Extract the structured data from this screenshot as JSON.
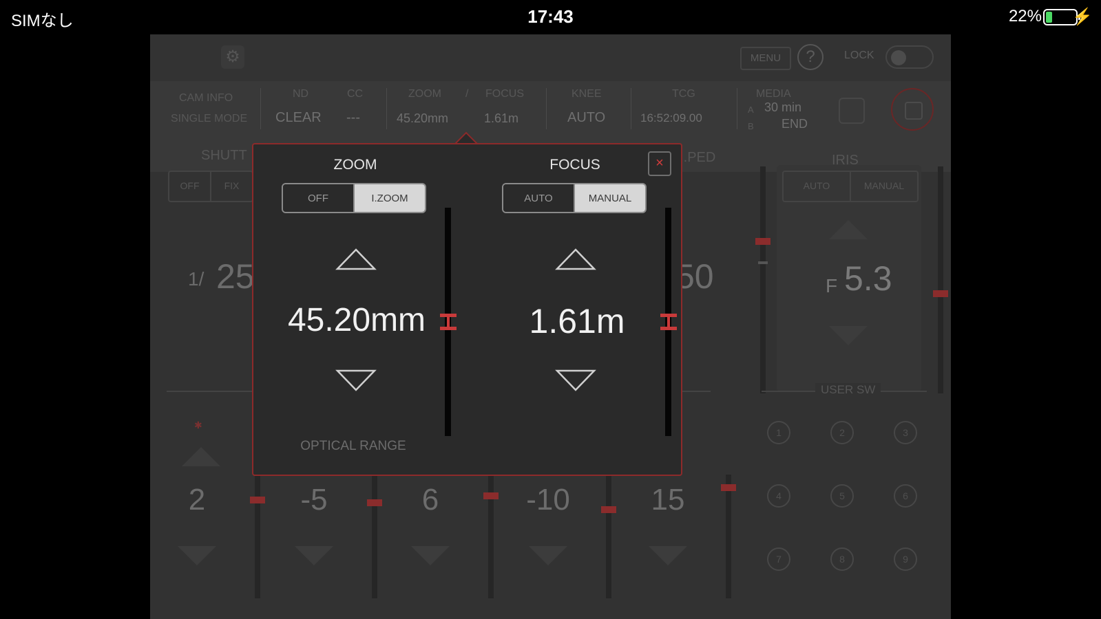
{
  "status_bar": {
    "carrier": "SIMなし",
    "time": "17:43",
    "battery": "22%",
    "battery_level": 0.22
  },
  "top_bar": {
    "menu_label": "MENU",
    "help_icon": "?",
    "lock_label": "LOCK"
  },
  "info_bar": {
    "cam_info": "CAM INFO",
    "mode": "SINGLE MODE",
    "nd_label": "ND",
    "nd_value": "CLEAR",
    "cc_label": "CC",
    "cc_value": "---",
    "zoom_label": "ZOOM",
    "focus_label": "FOCUS",
    "zoom_value": "45.20mm",
    "focus_value": "1.61m",
    "knee_label": "KNEE",
    "knee_value": "AUTO",
    "tcg_label": "TCG",
    "tcg_value": "16:52:09.00",
    "media_label": "MEDIA",
    "media_a_label": "A",
    "media_a_value": "30 min",
    "media_b_label": "B",
    "media_b_value": "END"
  },
  "background": {
    "shutter_label": "SHUTT",
    "shutter_off": "OFF",
    "shutter_fix": "FIX",
    "shutter_prefix": "1/",
    "shutter_value": "25",
    "speed_label": "M.PED",
    "speed_value": "50",
    "iris_label": "IRIS",
    "iris_auto": "AUTO",
    "iris_manual": "MANUAL",
    "iris_prefix": "F",
    "iris_value": "5.3",
    "user_sw_label": "USER SW",
    "bottom_values": [
      "2",
      "-5",
      "6",
      "-10",
      "15"
    ],
    "user_buttons": [
      "1",
      "2",
      "3",
      "4",
      "5",
      "6",
      "7",
      "8",
      "9"
    ]
  },
  "popup": {
    "zoom": {
      "title": "ZOOM",
      "options": [
        "OFF",
        "I.ZOOM"
      ],
      "selected": "I.ZOOM",
      "value": "45.20mm",
      "slider_level": 0.5
    },
    "focus": {
      "title": "FOCUS",
      "options": [
        "AUTO",
        "MANUAL"
      ],
      "selected": "MANUAL",
      "value": "1.61m",
      "slider_level": 0.5
    },
    "close_symbol": "×",
    "optical_range": "OPTICAL RANGE"
  }
}
